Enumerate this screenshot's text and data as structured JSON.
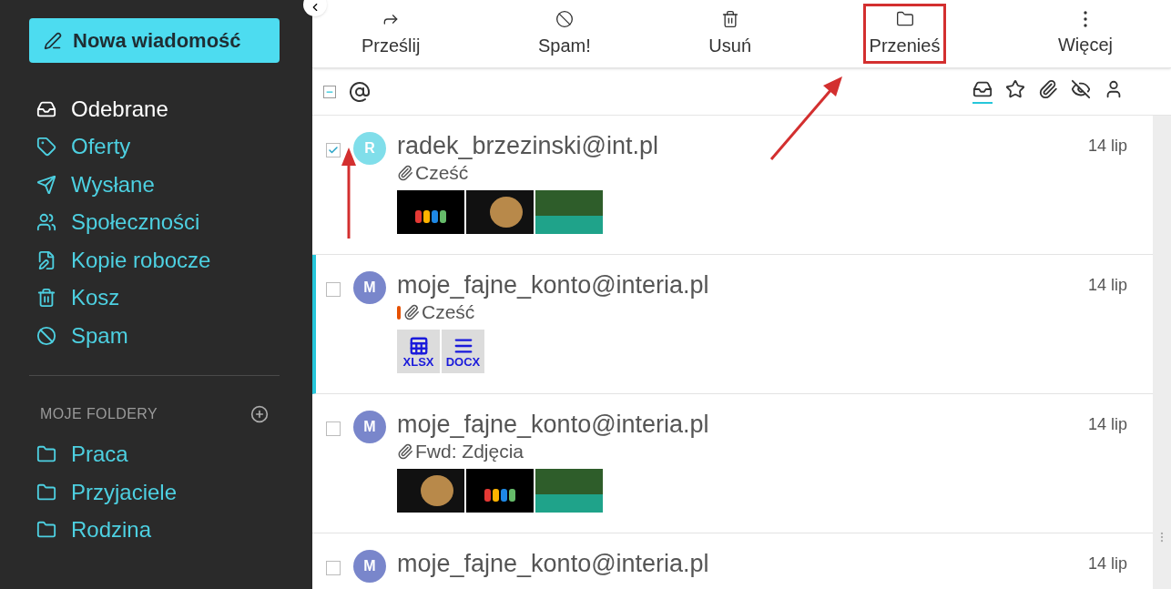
{
  "sidebar": {
    "compose_button": "Nowa wiadomość",
    "items": [
      {
        "label": "Odebrane",
        "kind": "inbox",
        "selected": true
      },
      {
        "label": "Oferty",
        "kind": "offers",
        "selected": false
      },
      {
        "label": "Wysłane",
        "kind": "sent",
        "selected": false
      },
      {
        "label": "Społeczności",
        "kind": "social",
        "selected": false
      },
      {
        "label": "Kopie robocze",
        "kind": "drafts",
        "selected": false
      },
      {
        "label": "Kosz",
        "kind": "trash",
        "selected": false
      },
      {
        "label": "Spam",
        "kind": "spam",
        "selected": false
      }
    ],
    "folders_heading": "MOJE FOLDERY",
    "folders": [
      {
        "label": "Praca",
        "selected": false
      },
      {
        "label": "Przyjaciele",
        "selected": false
      },
      {
        "label": "Rodzina",
        "selected": false
      }
    ]
  },
  "toolbar": [
    {
      "label": "Prześlij",
      "kind": "forward",
      "highlighted": false
    },
    {
      "label": "Spam!",
      "kind": "spam",
      "highlighted": false
    },
    {
      "label": "Usuń",
      "kind": "delete",
      "highlighted": false
    },
    {
      "label": "Przenieś",
      "kind": "move",
      "highlighted": true
    },
    {
      "label": "Więcej",
      "kind": "more",
      "highlighted": false
    }
  ],
  "select_all": {
    "indeterminate": true
  },
  "filters": [
    {
      "kind": "all",
      "selected": true
    },
    {
      "kind": "starred",
      "selected": false
    },
    {
      "kind": "attachments",
      "selected": false
    },
    {
      "kind": "unread",
      "selected": false
    },
    {
      "kind": "contacts",
      "selected": false
    }
  ],
  "messages": [
    {
      "checked": true,
      "active": false,
      "avatar": "R",
      "color": "#80deea",
      "sender": "radek_brzezinski@int.pl",
      "important": false,
      "attachment": true,
      "subject": "Cześć",
      "date": "14 lip",
      "attachments": [
        {
          "kind": "drinks"
        },
        {
          "kind": "lion"
        },
        {
          "kind": "river"
        }
      ]
    },
    {
      "checked": false,
      "active": true,
      "avatar": "M",
      "color": "#7986cb",
      "sender": "moje_fajne_konto@interia.pl",
      "important": true,
      "attachment": true,
      "subject": "Cześć",
      "date": "14 lip",
      "attachments": [
        {
          "kind": "xlsx",
          "label": "XLSX"
        },
        {
          "kind": "docx",
          "label": "DOCX"
        }
      ]
    },
    {
      "checked": false,
      "active": false,
      "avatar": "M",
      "color": "#7986cb",
      "sender": "moje_fajne_konto@interia.pl",
      "important": false,
      "attachment": true,
      "subject": "Fwd: Zdjęcia",
      "date": "14 lip",
      "attachments": [
        {
          "kind": "lion"
        },
        {
          "kind": "drinks"
        },
        {
          "kind": "river"
        }
      ]
    },
    {
      "checked": false,
      "active": false,
      "avatar": "M",
      "color": "#7986cb",
      "sender": "moje_fajne_konto@interia.pl",
      "date": "14 lip"
    }
  ]
}
